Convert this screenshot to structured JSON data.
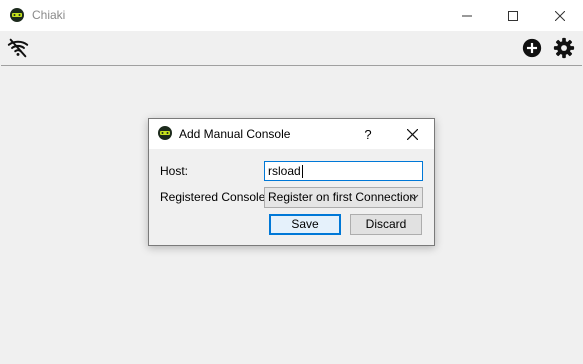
{
  "window": {
    "title": "Chiaki"
  },
  "toolbar": {
    "left_icon": "wifi-off-icon",
    "right_icons": [
      "add-circle-icon",
      "gear-icon"
    ]
  },
  "dialog": {
    "title": "Add Manual Console",
    "help_label": "?",
    "host_label": "Host:",
    "host_value": "rsload",
    "registered_label": "Registered Console:",
    "registered_value": "Register on first Connection",
    "save_label": "Save",
    "discard_label": "Discard"
  },
  "colors": {
    "accent": "#0078d7",
    "window_bg": "#f0f0f0",
    "title_text": "#8a8a8a"
  }
}
